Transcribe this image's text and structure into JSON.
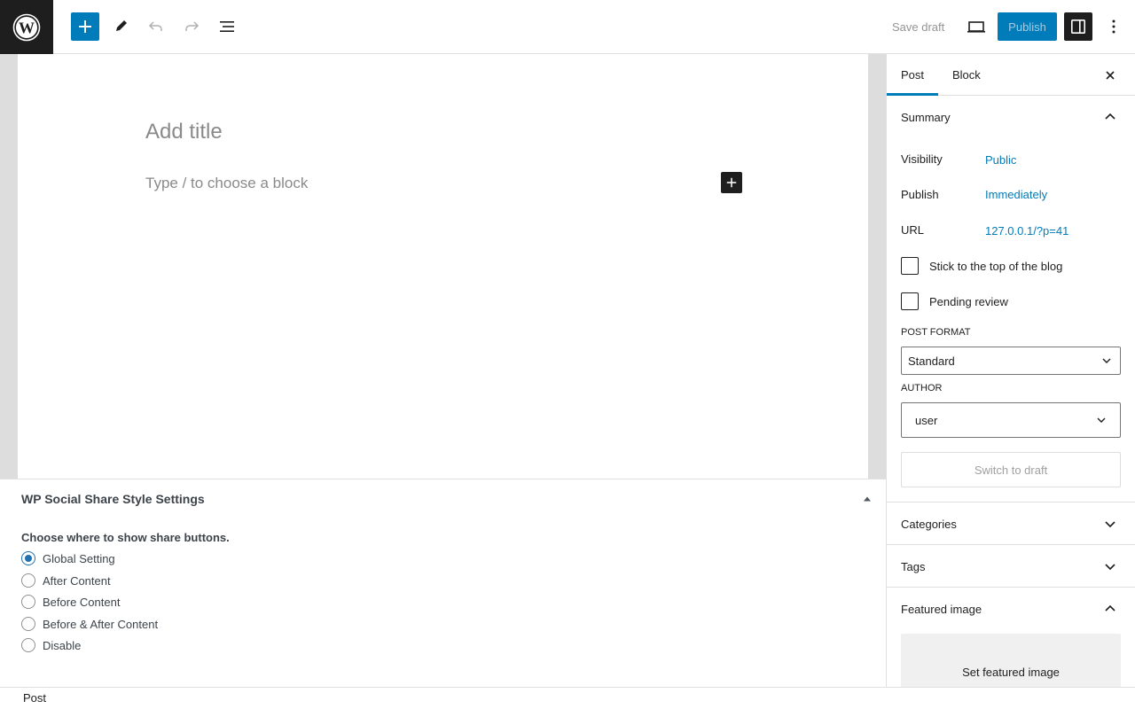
{
  "topbar": {
    "logo_icon": "wordpress-logo-icon",
    "toolbar_icons": [
      "plus-icon",
      "pencil-icon",
      "undo-icon",
      "redo-icon",
      "list-view-icon"
    ],
    "save_draft": "Save draft",
    "preview_icon": "desktop-preview-icon",
    "publish": "Publish",
    "settings_icon": "sidebar-settings-icon",
    "options_icon": "vertical-ellipsis-icon"
  },
  "editor": {
    "title_placeholder": "Add title",
    "block_placeholder": "Type / to choose a block"
  },
  "metabox": {
    "title": "WP Social Share Style Settings",
    "question": "Choose where to show share buttons.",
    "options": [
      "Global Setting",
      "After Content",
      "Before Content",
      "Before & After Content",
      "Disable"
    ],
    "selected": "Global Setting"
  },
  "footer": {
    "breadcrumb": "Post"
  },
  "sidebar": {
    "tabs": [
      "Post",
      "Block"
    ],
    "active_tab": "Post",
    "summary": {
      "title": "Summary",
      "visibility_label": "Visibility",
      "visibility_value": "Public",
      "publish_label": "Publish",
      "publish_value": "Immediately",
      "url_label": "URL",
      "url_value": "127.0.0.1/?p=41",
      "sticky_label": "Stick to the top of the blog",
      "pending_label": "Pending review",
      "post_format_label": "POST FORMAT",
      "post_format_value": "Standard",
      "author_label": "AUTHOR",
      "author_value": "user",
      "switch_to_draft": "Switch to draft"
    },
    "categories": "Categories",
    "tags": "Tags",
    "featured_image": "Featured image",
    "set_featured_image": "Set featured image"
  },
  "colors": {
    "accent": "#007cba",
    "dark": "#1e1e1e",
    "radio_accent": "#2271b1"
  }
}
